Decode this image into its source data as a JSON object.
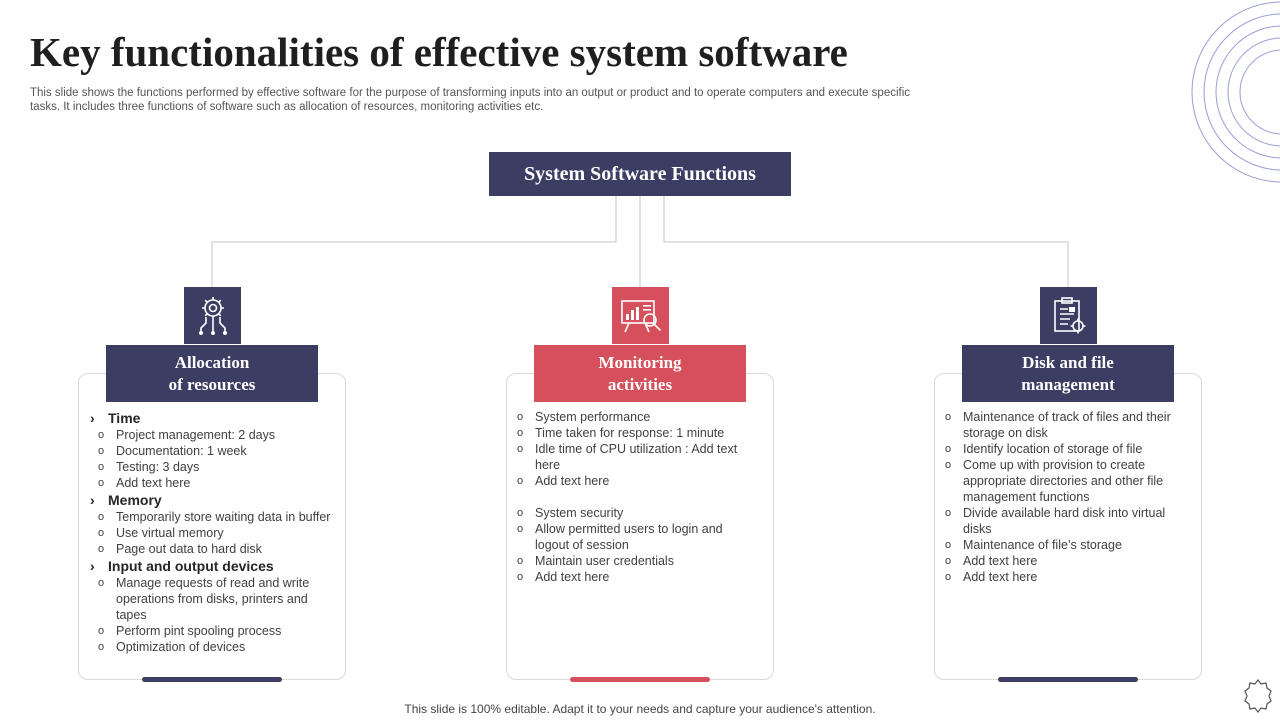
{
  "page": {
    "title": "Key functionalities of effective system software",
    "subtitle": "This slide shows the functions performed by effective software for the purpose of transforming inputs into an output or product and to operate computers and execute specific tasks. It includes three functions of software such as allocation of resources, monitoring activities etc.",
    "footer": "This slide is 100% editable. Adapt it to your needs and capture your audience's attention."
  },
  "colors": {
    "navy": "#3b3d63",
    "red": "#d5505c",
    "connector": "#d9d9d9"
  },
  "root": {
    "label": "System Software Functions"
  },
  "columns": [
    {
      "icon": "gear-circuit-icon",
      "header_line1": "Allocation",
      "header_line2": "of resources",
      "sections": [
        {
          "heading": "Time",
          "items": [
            "Project management:  2 days",
            "Documentation:  1 week",
            "Testing:  3 days",
            "Add text here"
          ]
        },
        {
          "heading": "Memory",
          "items": [
            "Temporarily  store waiting data in buffer",
            "Use virtual  memory",
            "Page out data to hard  disk"
          ]
        },
        {
          "heading": "Input and output devices",
          "items": [
            "Manage requests of read and write operations from disks, printers and tapes",
            "Perform  pint spooling process",
            "Optimization of devices"
          ]
        }
      ]
    },
    {
      "icon": "chart-magnifier-icon",
      "header_line1": "Monitoring",
      "header_line2": "activities",
      "groups": [
        [
          "System performance",
          "Time taken for response:  1 minute",
          "Idle time of CPU utilization : Add text here",
          "Add text here"
        ],
        [
          "System security",
          "Allow permitted users to login and logout of session",
          "Maintain user credentials",
          "Add text here"
        ]
      ]
    },
    {
      "icon": "document-gear-icon",
      "header_line1": "Disk and file",
      "header_line2": "management",
      "items": [
        "Maintenance of track of files and their storage on disk",
        "Identify location of storage of file",
        "Come up with provision  to create appropriate  directories and other file management  functions",
        "Divide  available  hard disk into virtual  disks",
        "Maintenance of file’s storage",
        "Add text here",
        "Add text here"
      ]
    }
  ]
}
